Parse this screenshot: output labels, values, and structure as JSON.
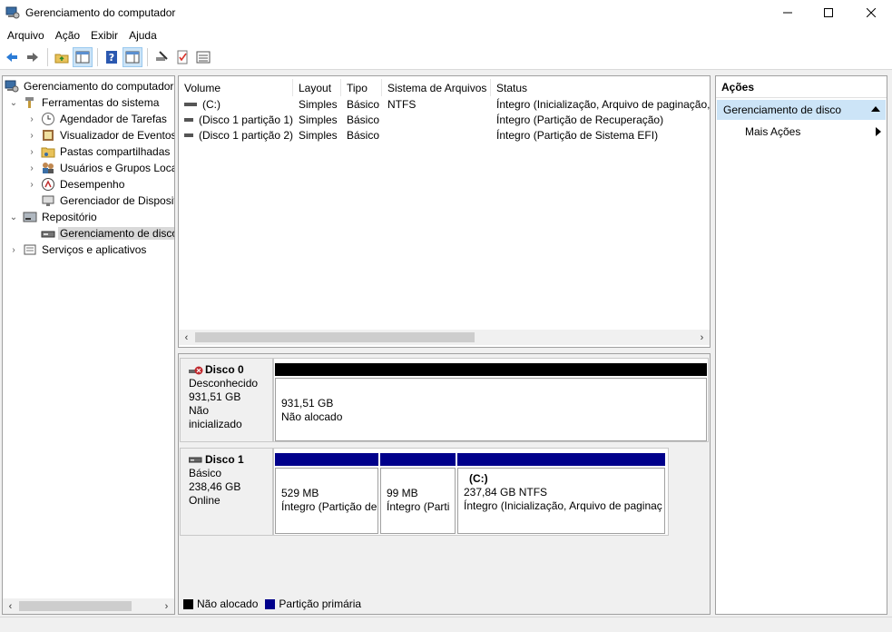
{
  "window": {
    "title": "Gerenciamento do computador",
    "icon": "computer-management-icon"
  },
  "menu": [
    "Arquivo",
    "Ação",
    "Exibir",
    "Ajuda"
  ],
  "toolbar": {
    "icons": [
      "back-arrow-icon",
      "forward-arrow-icon",
      "up-folder-icon",
      "show-hide-tree-icon",
      "help-icon",
      "properties-view-icon",
      "rescan-icon",
      "check-icon",
      "list-icon"
    ]
  },
  "tree": {
    "items": [
      {
        "label": "Gerenciamento do computador",
        "icon": "computer-management-icon"
      },
      {
        "label": "Ferramentas do sistema",
        "icon": "tools-icon"
      },
      {
        "label": "Agendador de Tarefas",
        "icon": "clock-icon"
      },
      {
        "label": "Visualizador de Eventos",
        "icon": "event-viewer-icon"
      },
      {
        "label": "Pastas compartilhadas",
        "icon": "shared-folder-icon"
      },
      {
        "label": "Usuários e Grupos Loca",
        "icon": "users-icon"
      },
      {
        "label": "Desempenho",
        "icon": "performance-icon"
      },
      {
        "label": "Gerenciador de Disposit",
        "icon": "device-manager-icon"
      },
      {
        "label": "Repositório",
        "icon": "storage-icon"
      },
      {
        "label": "Gerenciamento de disco",
        "icon": "disk-icon"
      },
      {
        "label": "Serviços e aplicativos",
        "icon": "services-icon"
      }
    ]
  },
  "volumes": {
    "columns": [
      "Volume",
      "Layout",
      "Tipo",
      "Sistema de Arquivos",
      "Status"
    ],
    "rows": [
      {
        "volume": "(C:)",
        "layout": "Simples",
        "tipo": "Básico",
        "fs": "NTFS",
        "status": "Íntegro (Inicialização, Arquivo de paginação,"
      },
      {
        "volume": "(Disco 1 partição 1)",
        "layout": "Simples",
        "tipo": "Básico",
        "fs": "",
        "status": "Íntegro (Partição de Recuperação)"
      },
      {
        "volume": "(Disco 1 partição 2)",
        "layout": "Simples",
        "tipo": "Básico",
        "fs": "",
        "status": "Íntegro (Partição de Sistema EFI)"
      }
    ]
  },
  "disks": [
    {
      "name": "Disco 0",
      "type": "Desconhecido",
      "size": "931,51 GB",
      "state": "Não inicializado",
      "partitions": [
        {
          "size": "931,51 GB",
          "status": "Não alocado"
        }
      ]
    },
    {
      "name": "Disco 1",
      "type": "Básico",
      "size": "238,46 GB",
      "state": "Online",
      "partitions": [
        {
          "label": "",
          "size": "529 MB",
          "status": "Íntegro (Partição de"
        },
        {
          "label": "",
          "size": "99 MB",
          "status": "Íntegro (Parti"
        },
        {
          "label": "(C:)",
          "size": "237,84 GB NTFS",
          "status": "Íntegro (Inicialização, Arquivo de paginaç"
        }
      ]
    }
  ],
  "legend": [
    {
      "label": "Não alocado",
      "color": "#000000"
    },
    {
      "label": "Partição primária",
      "color": "#00008b"
    }
  ],
  "actions": {
    "title": "Ações",
    "section": "Gerenciamento de disco",
    "item": "Mais Ações"
  },
  "colors": {
    "primary_partition": "#00008b",
    "unallocated": "#000000",
    "selection": "#cce4f7"
  }
}
